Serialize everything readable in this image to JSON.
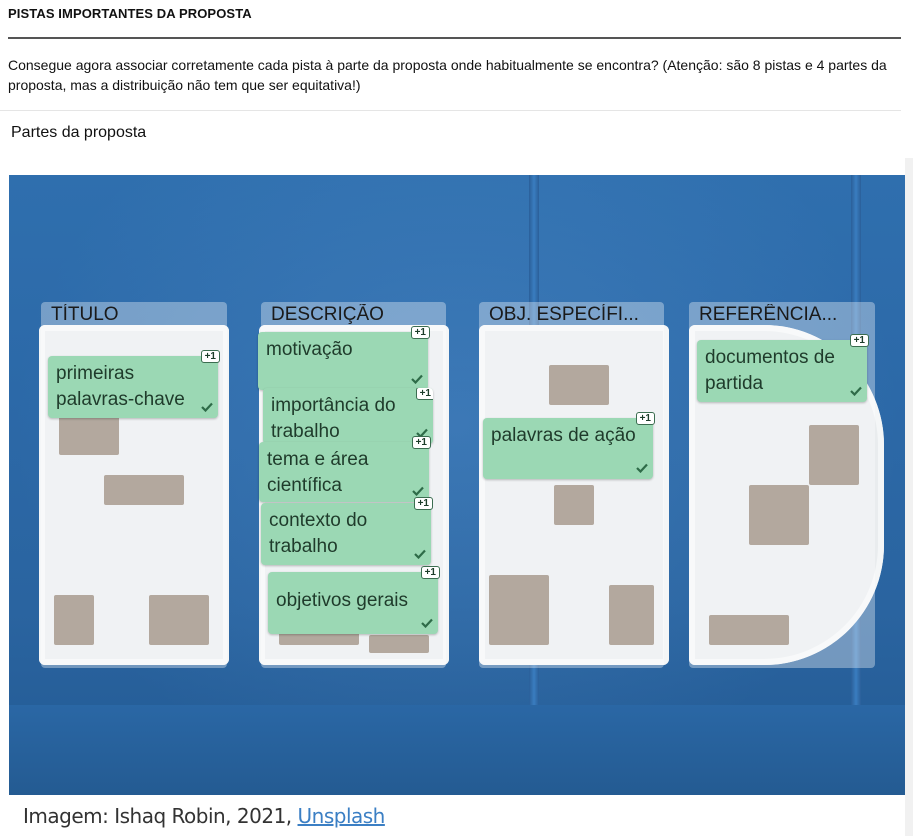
{
  "header": {
    "title": "PISTAS IMPORTANTES DA PROPOSTA"
  },
  "instructions": "Consegue agora associar corretamente cada pista à parte da proposta onde habitualmente se encontra? (Atenção: são 8 pistas e 4 partes da proposta, mas a distribuição não tem que ser equitativa!)",
  "section_label": "Partes da proposta",
  "colors": {
    "card_bg": "#9bd8b4",
    "card_text": "#1f3b2b",
    "check": "#2e6b48",
    "wall": "#2c69a8",
    "link": "#3b7fc4"
  },
  "zones": [
    {
      "label": "TÍTULO"
    },
    {
      "label": "DESCRIÇÃO"
    },
    {
      "label": "OBJ. ESPECÍFI..."
    },
    {
      "label": "REFERÊNCIA..."
    }
  ],
  "cards": [
    {
      "text": "primeiras palavras-chave",
      "badge": "+1",
      "icon": "check-icon"
    },
    {
      "text": "motivação",
      "badge": "+1",
      "icon": "check-icon"
    },
    {
      "text": "importância do trabalho",
      "badge": "+1",
      "icon": "check-icon"
    },
    {
      "text": "tema e área científica",
      "badge": "+1",
      "icon": "check-icon"
    },
    {
      "text": "contexto do trabalho",
      "badge": "+1",
      "icon": "check-icon"
    },
    {
      "text": "objetivos gerais",
      "badge": "+1",
      "icon": "check-icon"
    },
    {
      "text": "palavras de ação",
      "badge": "+1",
      "icon": "check-icon"
    },
    {
      "text": "documentos de partida",
      "badge": "+1",
      "icon": "check-icon"
    }
  ],
  "caption": {
    "prefix": "Imagem: Ishaq Robin, 2021, ",
    "link": "Unsplash"
  }
}
